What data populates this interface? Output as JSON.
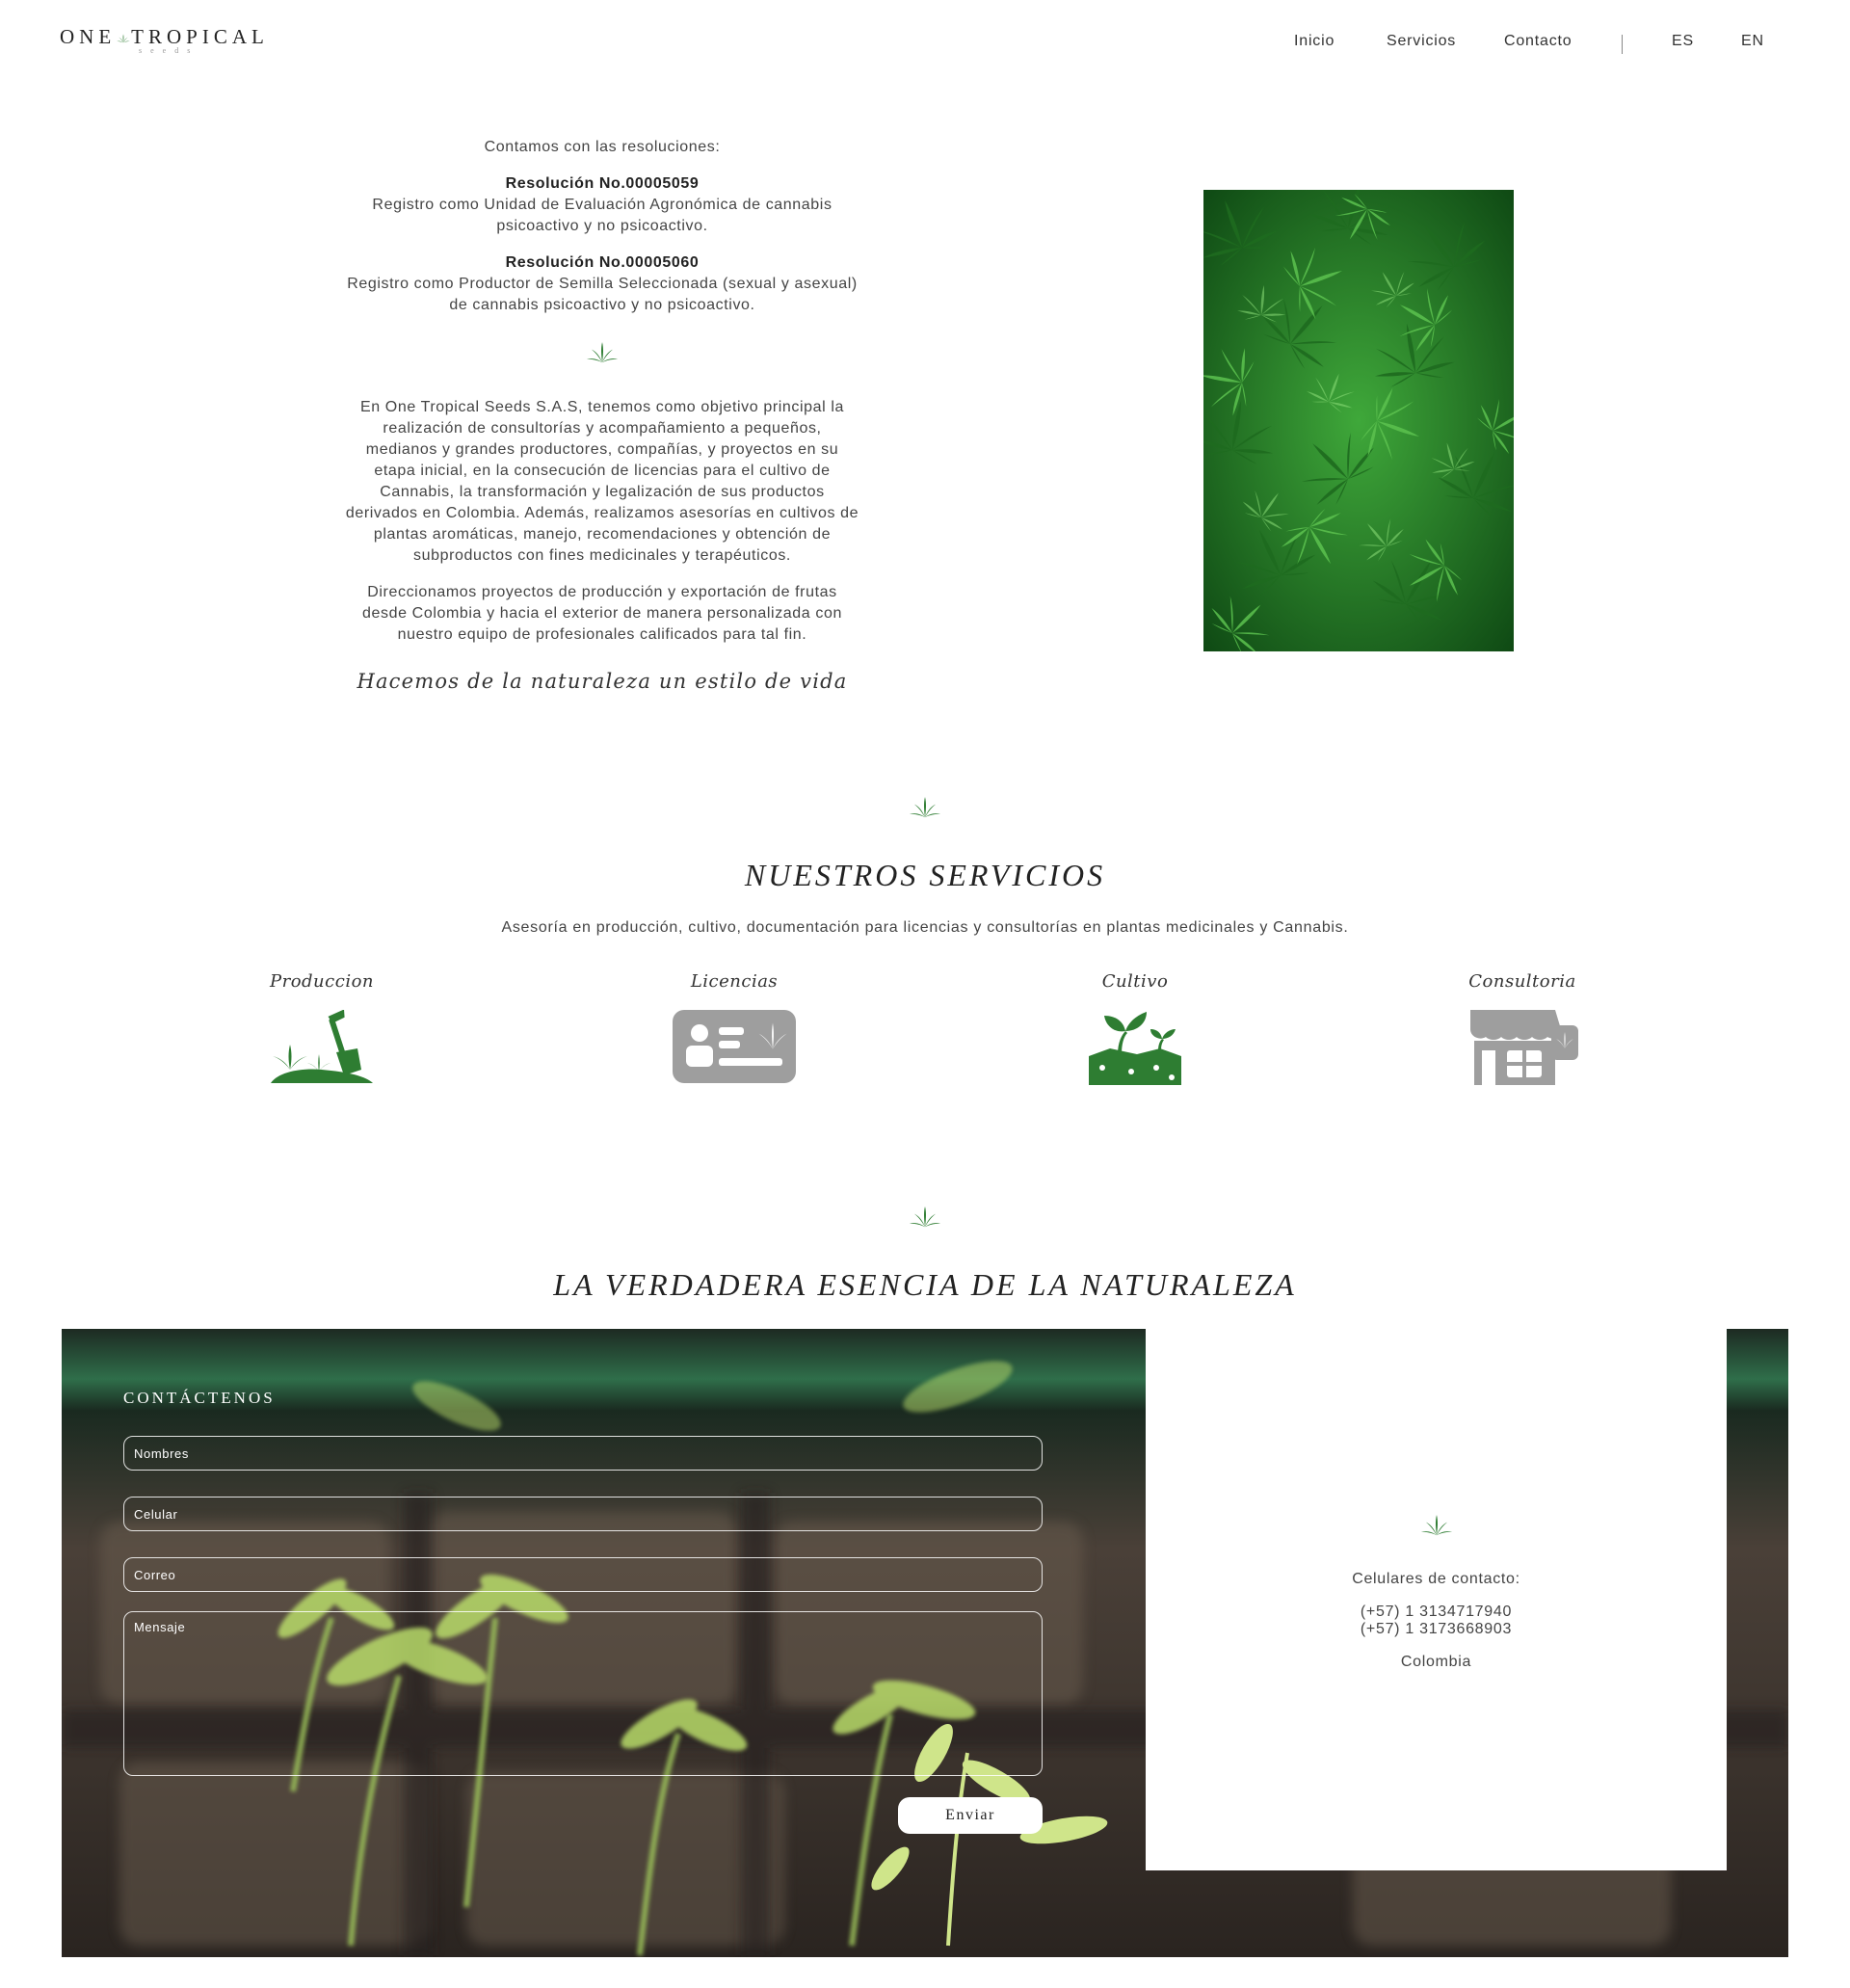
{
  "header": {
    "logo_main_left": "ONE",
    "logo_main_right": "TROPICAL",
    "logo_sub": "seeds",
    "nav": {
      "home": "Inicio",
      "services": "Servicios",
      "contact": "Contacto",
      "lang_es": "ES",
      "lang_en": "EN"
    }
  },
  "intro": {
    "resolutions_heading": "Contamos con las resoluciones:",
    "res1_title": "Resolución No.00005059",
    "res1_line1": "Registro como Unidad de Evaluación Agronómica de cannabis",
    "res1_line2": "psicoactivo y no psicoactivo.",
    "res2_title": "Resolución No.00005060",
    "res2_line1": "Registro como Productor de Semilla Seleccionada (sexual y asexual)",
    "res2_line2": "de cannabis psicoactivo y no psicoactivo.",
    "para1": [
      "En One Tropical Seeds S.A.S, tenemos como objetivo principal la",
      "realización de consultorías y acompañamiento a pequeños,",
      "medianos y grandes productores, compañías, y proyectos en su",
      "etapa inicial, en la consecución de licencias para el cultivo de",
      "Cannabis, la transformación y legalización de sus productos",
      "derivados en Colombia. Además, realizamos asesorías en cultivos de",
      "plantas aromáticas, manejo, recomendaciones y obtención de",
      "subproductos con fines medicinales y terapéuticos."
    ],
    "para2": [
      "Direccionamos proyectos de producción y exportación de frutas",
      "desde Colombia y hacia el exterior de manera personalizada con",
      "nuestro equipo de profesionales calificados para tal fin."
    ],
    "tagline": "Hacemos de la naturaleza un estilo de vida"
  },
  "services": {
    "title": "NUESTROS SERVICIOS",
    "subtitle": "Asesoría en producción, cultivo, documentación para licencias y consultorías en plantas medicinales y Cannabis.",
    "items": [
      {
        "label": "Produccion",
        "icon": "shovel-plant-icon"
      },
      {
        "label": "Licencias",
        "icon": "license-card-icon"
      },
      {
        "label": "Cultivo",
        "icon": "sprout-soil-icon"
      },
      {
        "label": "Consultoria",
        "icon": "store-leaf-icon"
      }
    ],
    "colors": {
      "green": "#2e7d32",
      "gray": "#9e9e9e"
    }
  },
  "essence": {
    "title": "LA VERDADERA ESENCIA DE LA NATURALEZA"
  },
  "contact": {
    "form_title": "CONTÁCTENOS",
    "name_placeholder": "Nombres",
    "phone_placeholder": "Celular",
    "email_placeholder": "Correo",
    "message_placeholder": "Mensaje",
    "send_label": "Enviar",
    "phones_heading": "Celulares de contacto:",
    "phone1": "(+57) 1 3134717940",
    "phone2": "(+57) 1 3173668903",
    "country": "Colombia"
  }
}
